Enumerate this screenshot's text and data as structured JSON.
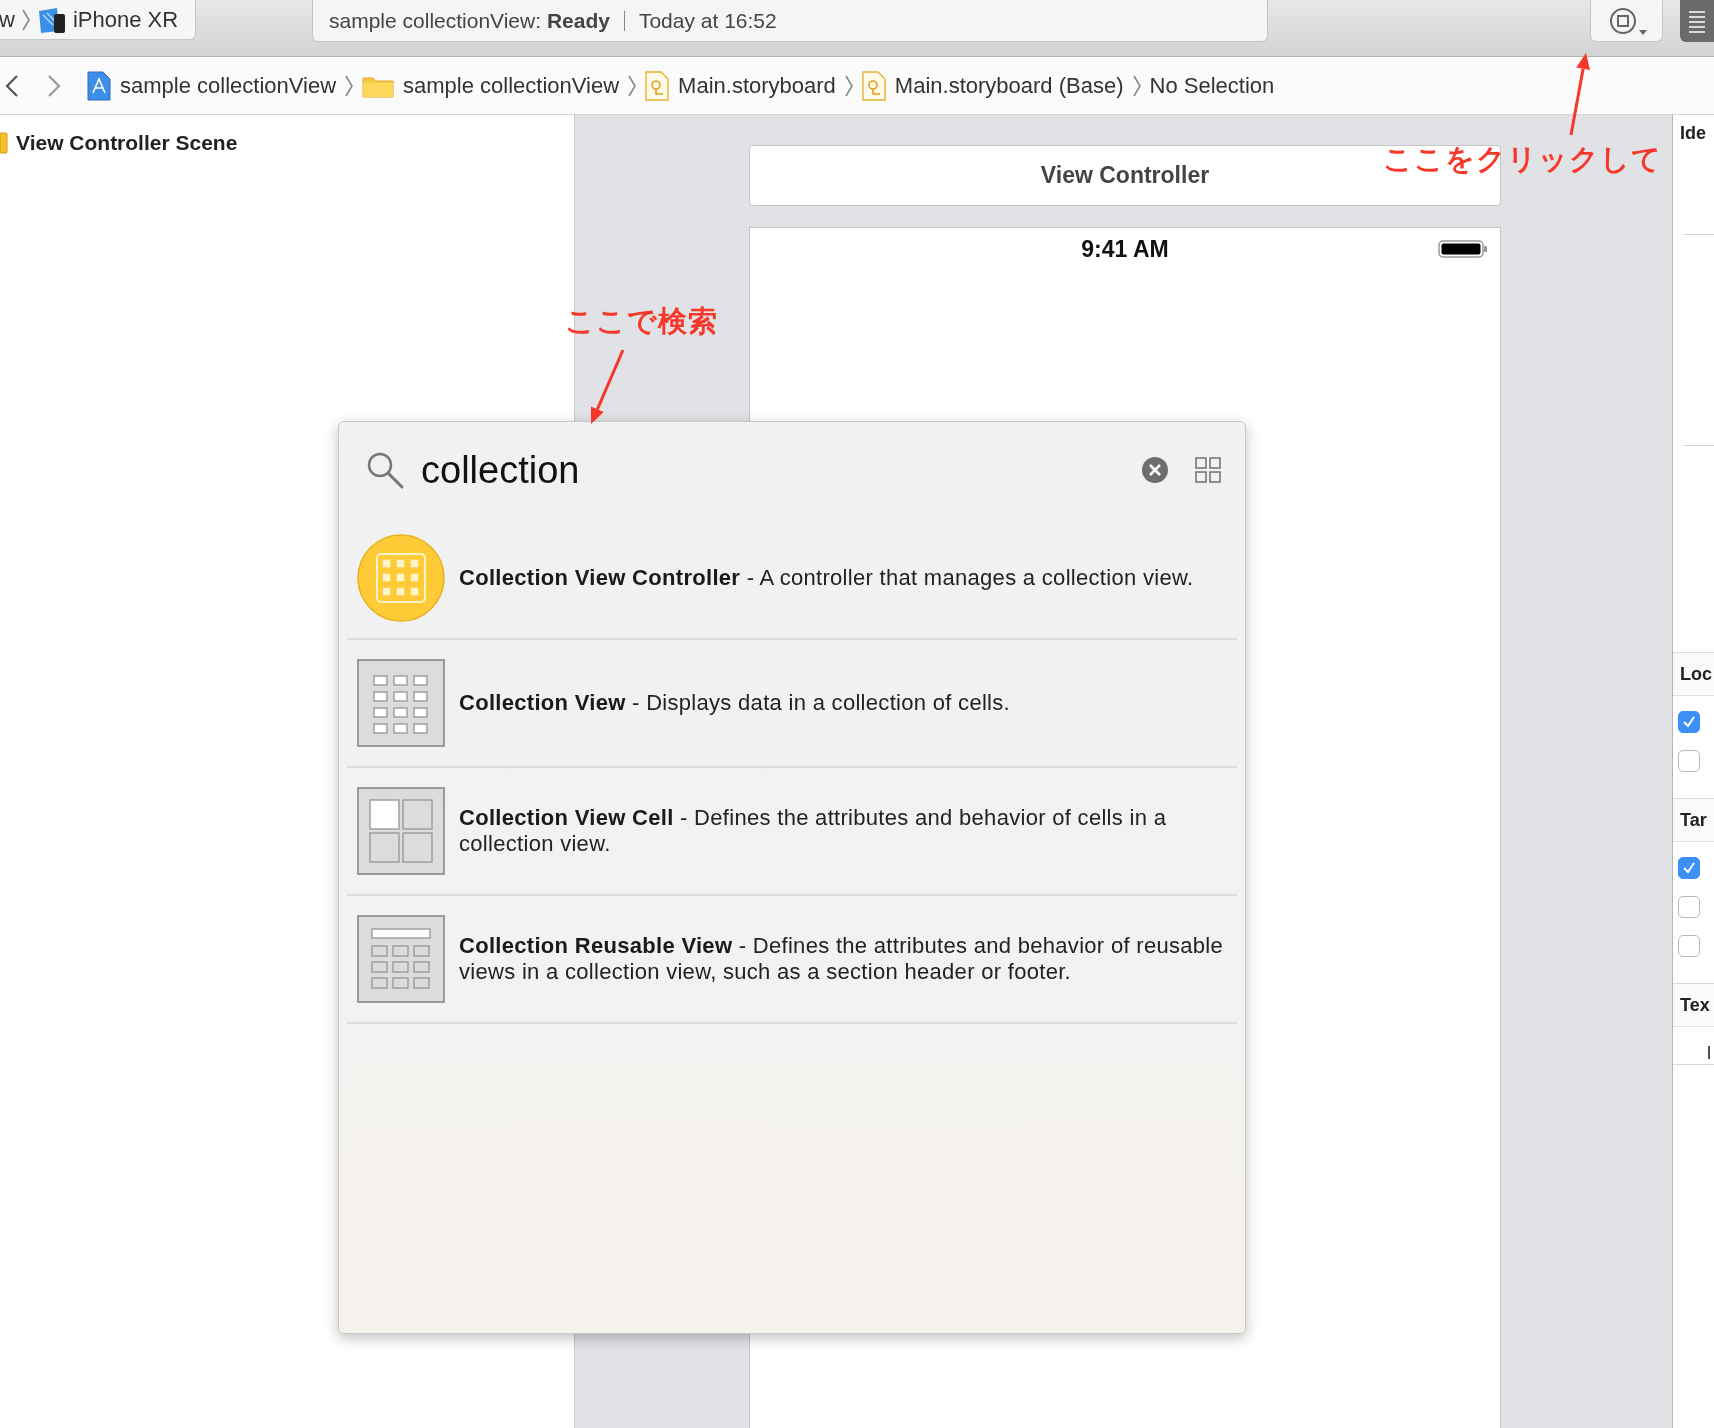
{
  "toolbar": {
    "scheme_tail": "w",
    "device": "iPhone XR",
    "activity": {
      "text": "sample collectionView: **Ready**",
      "time": "Today at 16:52"
    }
  },
  "jump_bar": {
    "items": [
      {
        "kind": "project",
        "label": "sample collectionView"
      },
      {
        "kind": "folder",
        "label": "sample collectionView"
      },
      {
        "kind": "storyboard",
        "label": "Main.storyboard"
      },
      {
        "kind": "storyboard",
        "label": "Main.storyboard (Base)"
      },
      {
        "kind": "plain",
        "label": "No Selection"
      }
    ]
  },
  "navigator": {
    "scene": "View Controller Scene"
  },
  "canvas": {
    "scene_title": "View Controller",
    "status_time": "9:41 AM"
  },
  "library": {
    "search": {
      "value": "collection"
    },
    "results": [
      {
        "kind": "controller",
        "text": "**Collection View Controller** - A controller that manages a collection view."
      },
      {
        "kind": "view",
        "text": "**Collection View** - Displays data in a collection of cells."
      },
      {
        "kind": "cell",
        "text": "**Collection View Cell** - Defines the attributes and behavior of cells in a collection view."
      },
      {
        "kind": "reusable",
        "text": "**Collection Reusable View** - Defines the attributes and behavior of reusable views in a collection view, such as a section header or footer."
      }
    ]
  },
  "inspector": {
    "sections": [
      {
        "title": "Ide"
      },
      {
        "title": "Loc",
        "checkboxes": [
          {
            "checked": true
          },
          {
            "checked": false
          }
        ]
      },
      {
        "title": "Tar",
        "checkboxes": [
          {
            "checked": true
          },
          {
            "checked": false
          },
          {
            "checked": false
          }
        ]
      },
      {
        "title": "Tex",
        "value": "l"
      }
    ]
  },
  "annotations": [
    {
      "text": "ここをクリックして"
    },
    {
      "text": "ここで検索"
    }
  ]
}
